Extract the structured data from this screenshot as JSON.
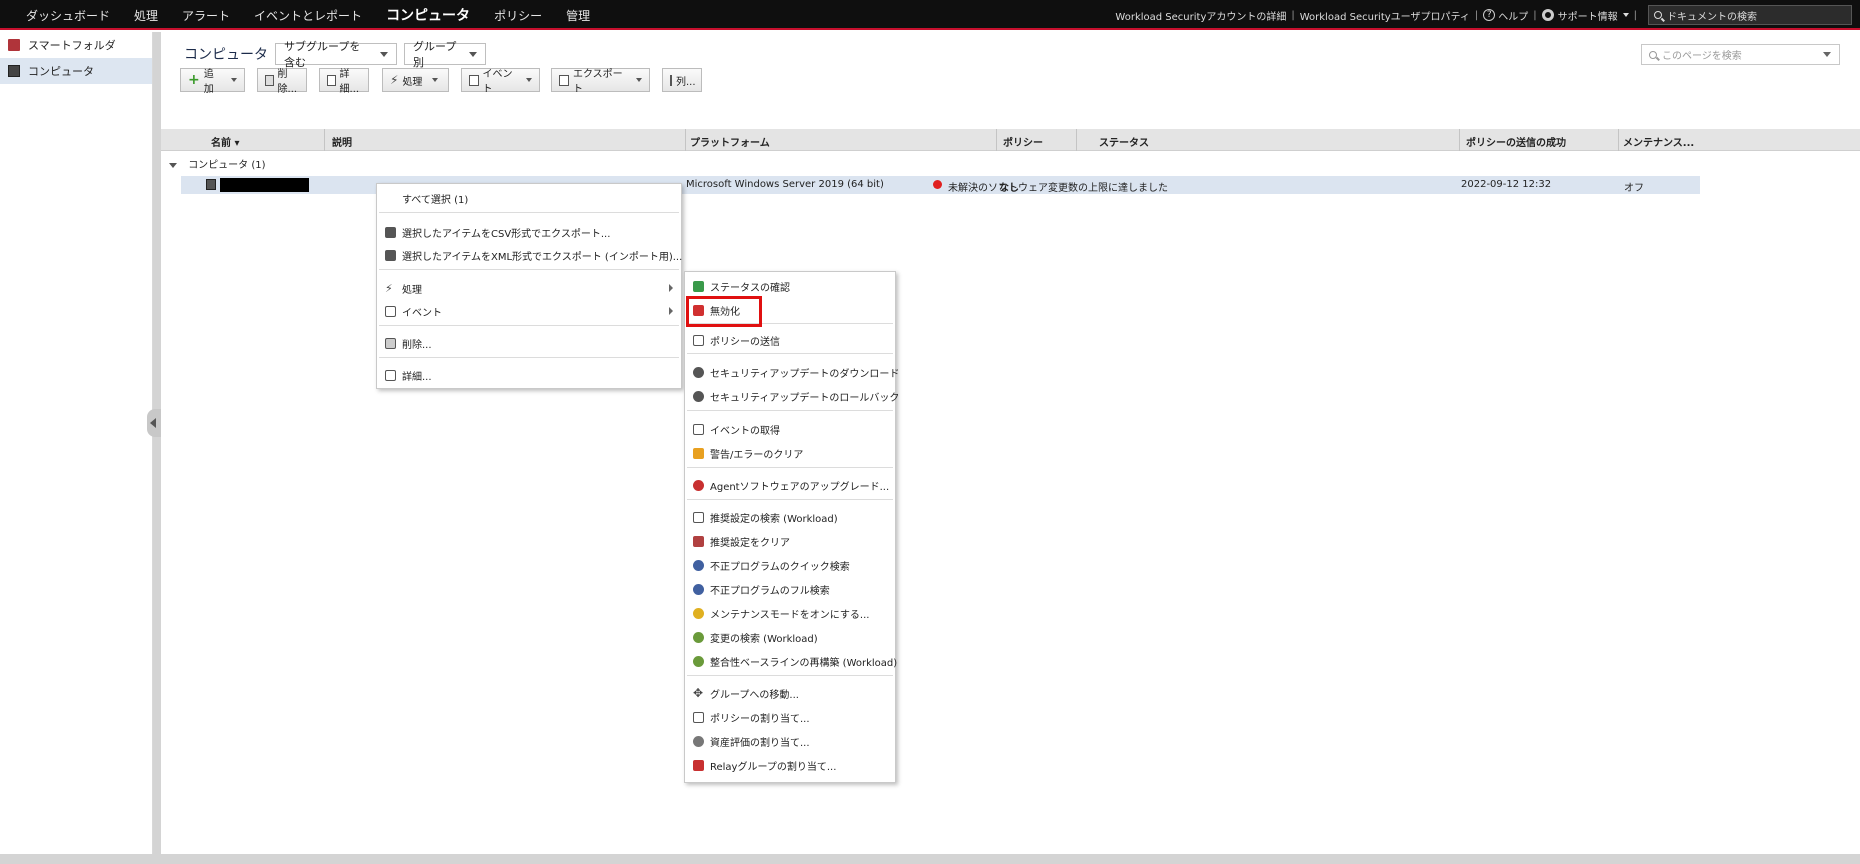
{
  "topnav": {
    "items": [
      "ダッシュボード",
      "処理",
      "アラート",
      "イベントとレポート",
      "コンピュータ",
      "ポリシー",
      "管理"
    ],
    "active": "コンピュータ",
    "account_details": "Workload Securityアカウントの詳細",
    "user_properties": "Workload Securityユーザプロパティ",
    "help": "ヘルプ",
    "support": "サポート情報",
    "doc_search_placeholder": "ドキュメントの検索"
  },
  "sidebar": {
    "items": [
      {
        "label": "スマートフォルダ",
        "icon": "smart-folder-icon"
      },
      {
        "label": "コンピュータ",
        "icon": "computer-icon"
      }
    ]
  },
  "main": {
    "title": "コンピュータ",
    "subgroup_dropdown": "サブグループを含む",
    "group_dropdown": "グループ別",
    "page_search_placeholder": "このページを検索",
    "toolbar": {
      "add": "追加",
      "delete": "削除...",
      "details": "詳細...",
      "actions": "処理",
      "events": "イベント",
      "export": "エクスポート",
      "columns": "列..."
    },
    "columns": {
      "name": "名前",
      "description": "説明",
      "platform": "プラットフォーム",
      "policy": "ポリシー",
      "status": "ステータス",
      "policy_sent": "ポリシーの送信の成功",
      "maintenance": "メンテナンス..."
    },
    "group_label": "コンピュータ (1)",
    "row": {
      "platform": "Microsoft Windows Server 2019 (64 bit)",
      "policy": "なし",
      "status": "未解決のソフトウェア変更数の上限に達しました",
      "status_color": "#e02020",
      "policy_sent": "2022-09-12 12:32",
      "maintenance": "オフ"
    }
  },
  "context_menu": {
    "select_all": "すべて選択 (1)",
    "export_csv": "選択したアイテムをCSV形式でエクスポート...",
    "export_xml": "選択したアイテムをXML形式でエクスポート (インポート用)...",
    "actions": "処理",
    "events": "イベント",
    "delete": "削除...",
    "details": "詳細..."
  },
  "submenu": {
    "items": [
      "ステータスの確認",
      "無効化",
      "ポリシーの送信",
      "セキュリティアップデートのダウンロード",
      "セキュリティアップデートのロールバック",
      "イベントの取得",
      "警告/エラーのクリア",
      "Agentソフトウェアのアップグレード...",
      "推奨設定の検索 (Workload)",
      "推奨設定をクリア",
      "不正プログラムのクイック検索",
      "不正プログラムのフル検索",
      "メンテナンスモードをオンにする...",
      "変更の検索 (Workload)",
      "整合性ベースラインの再構築 (Workload)",
      "グループへの移動...",
      "ポリシーの割り当て...",
      "資産評価の割り当て...",
      "Relayグループの割り当て..."
    ],
    "highlight_color": "#e01010"
  }
}
